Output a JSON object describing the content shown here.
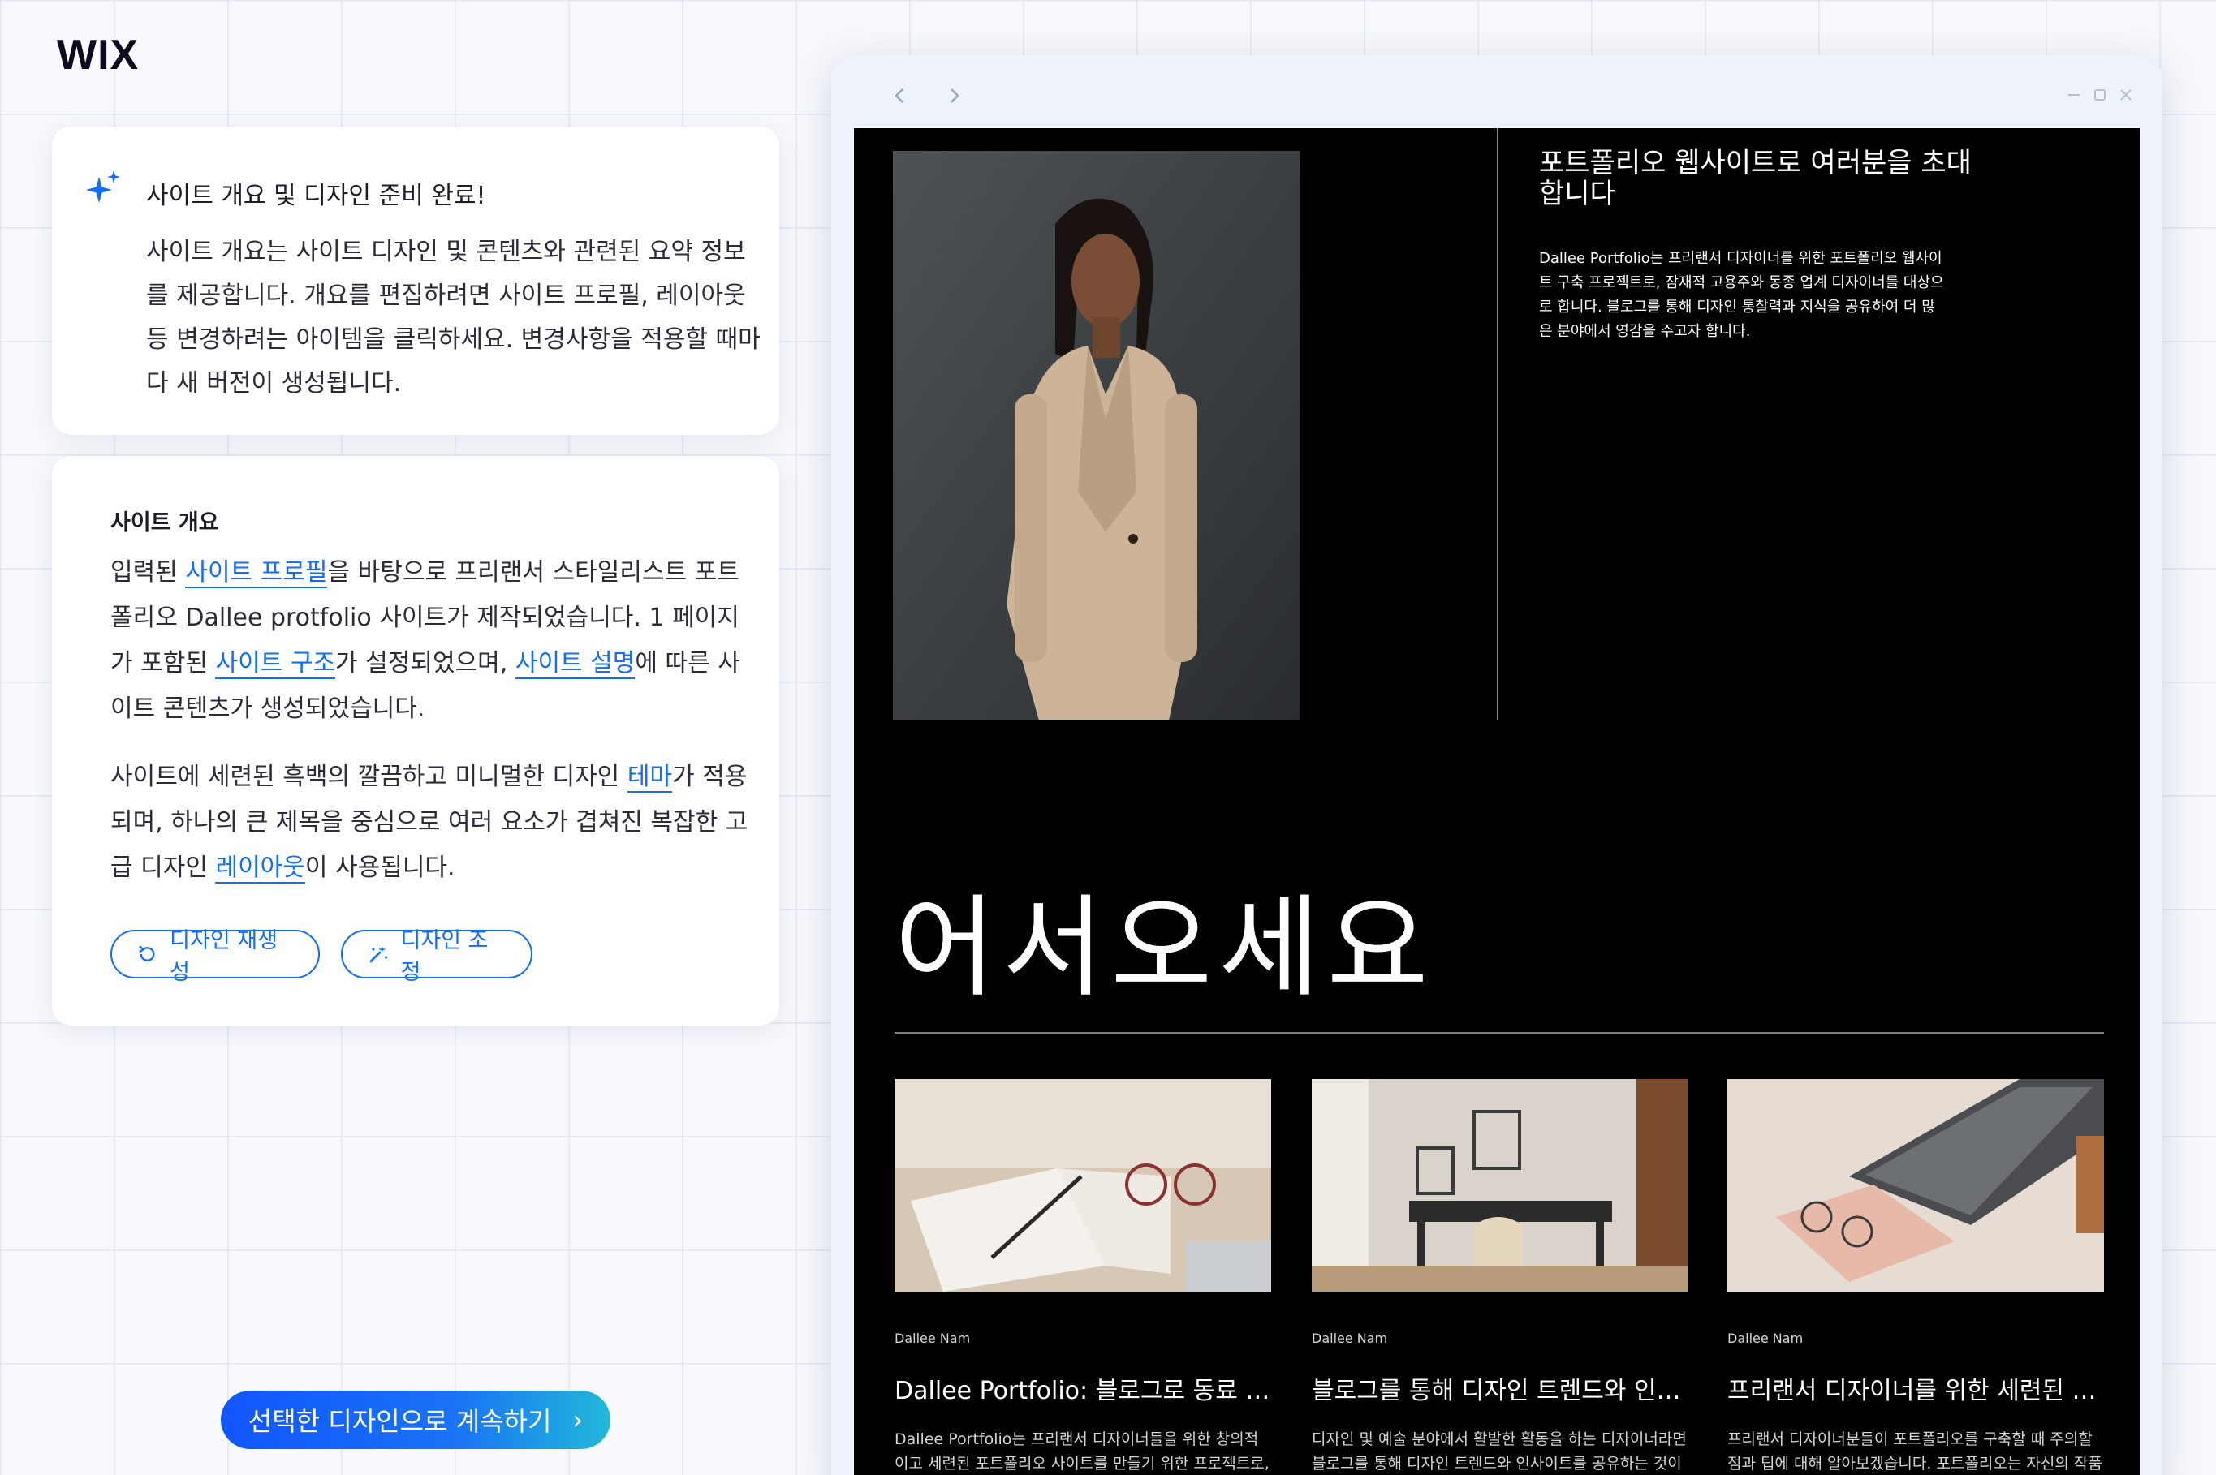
{
  "brand": {
    "logo": "WIX"
  },
  "ai_card": {
    "title": "사이트 개요 및 디자인 준비 완료!",
    "description": "사이트 개요는 사이트 디자인 및 콘텐츠와 관련된 요약 정보를 제공합니다. 개요를 편집하려면 사이트 프로필, 레이아웃 등 변경하려는 아이템을 클릭하세요. 변경사항을 적용할 때마다 새 버전이 생성됩니다."
  },
  "summary_card": {
    "heading": "사이트 개요",
    "p1_a": "입력된 ",
    "link_profile": "사이트 프로필",
    "p1_b": "을 바탕으로 프리랜서 스타일리스트 포트폴리오 Dallee protfolio 사이트가 제작되었습니다. 1 페이지가 포함된 ",
    "link_structure": "사이트 구조",
    "p1_c": "가 설정되었으며, ",
    "link_description": "사이트 설명",
    "p1_d": "에 따른 사이트 콘텐츠가 생성되었습니다.",
    "p2_a": "사이트에 세련된 흑백의 깔끔하고 미니멀한 디자인 ",
    "link_theme": "테마",
    "p2_b": "가 적용되며, 하나의 큰 제목을 중심으로 여러 요소가 겹쳐진 복잡한 고급 디자인 ",
    "link_layout": "레이아웃",
    "p2_c": "이 사용됩니다.",
    "regenerate_label": "디자인 재생성",
    "adjust_label": "디자인 조정"
  },
  "continue_button": {
    "label": "선택한 디자인으로 계속하기",
    "chevron": "›"
  },
  "preview": {
    "heading": "포트폴리오 웹사이트로 여러분을 초대합니다",
    "intro": "Dallee Portfolio는 프리랜서 디자이너를 위한 포트폴리오 웹사이트 구축 프로젝트로, 잠재적 고용주와 동종 업계 디자이너를 대상으로 합니다. 블로그를 통해 디자인 통찰력과 지식을 공유하여 더 많은 분야에서 영감을 주고자 합니다.",
    "welcome": "어서오세요",
    "posts": [
      {
        "author": "Dallee Nam",
        "title": "Dallee Portfolio: 블로그로 동료 디자이너들과 소통하기",
        "excerpt": "Dallee Portfolio는 프리랜서 디자이너들을 위한 창의적이고 세련된 포트폴리오 사이트를 만들기 위한 프로젝트로, 동료 디자이너들과의 소통을 강조합니다. 이 사이트는 주로"
      },
      {
        "author": "Dallee Nam",
        "title": "블로그를 통해 디자인 트렌드와 인사이트 공유하기",
        "excerpt": "디자인 및 예술 분야에서 활발한 활동을 하는 디자이너라면 블로그를 통해 디자인 트렌드와 인사이트를 공유하는 것이 중요한 요소일 수 있습니다. Dallee Portfolio는 프리랜"
      },
      {
        "author": "Dallee Nam",
        "title": "프리랜서 디자이너를 위한 세련된 포트폴리오 구축 팁",
        "excerpt": "프리랜서 디자이너분들이 포트폴리오를 구축할 때 주의할 점과 팁에 대해 알아보겠습니다. 포트폴리오는 자신의 작품을 보여주는 창구로, 다른 사람들에게 자신의 디자인"
      }
    ]
  },
  "colors": {
    "accent": "#116dff",
    "site_bg": "#000000"
  }
}
